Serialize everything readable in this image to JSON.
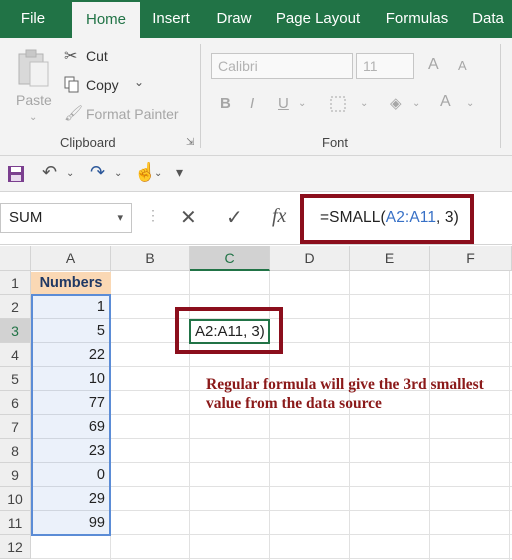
{
  "ribbon_tabs": [
    "File",
    "Home",
    "Insert",
    "Draw",
    "Page Layout",
    "Formulas",
    "Data"
  ],
  "clipboard": {
    "paste_label": "Paste",
    "cut_label": "Cut",
    "copy_label": "Copy",
    "format_painter_label": "Format Painter",
    "group_label": "Clipboard"
  },
  "font": {
    "font_name": "Calibri",
    "font_size": "11",
    "bold_label": "B",
    "italic_label": "I",
    "underline_label": "U",
    "grow_label": "A",
    "shrink_label": "A",
    "color_label": "A",
    "group_label": "Font"
  },
  "formula_bar": {
    "name_box": "SUM",
    "fx_label": "fx",
    "formula_prefix": "=SMALL(",
    "formula_ref": "A2:A11",
    "formula_suffix": ", 3)"
  },
  "sheet": {
    "columns": [
      "A",
      "B",
      "C",
      "D",
      "E",
      "F"
    ],
    "rows": [
      "1",
      "2",
      "3",
      "4",
      "5",
      "6",
      "7",
      "8",
      "9",
      "10",
      "11",
      "12"
    ],
    "header": "Numbers",
    "values": [
      "1",
      "5",
      "22",
      "10",
      "77",
      "69",
      "23",
      "0",
      "29",
      "99"
    ],
    "editing_cell_ref": "A2:A11",
    "editing_cell_suffix": ", 3)",
    "note": "Regular formula will give the 3rd smallest value from the data source"
  },
  "colors": {
    "accent": "#217346",
    "highlight_border": "#8b0e1c",
    "range_ref": "#3770c6",
    "header_fill": "#fad8b4"
  }
}
